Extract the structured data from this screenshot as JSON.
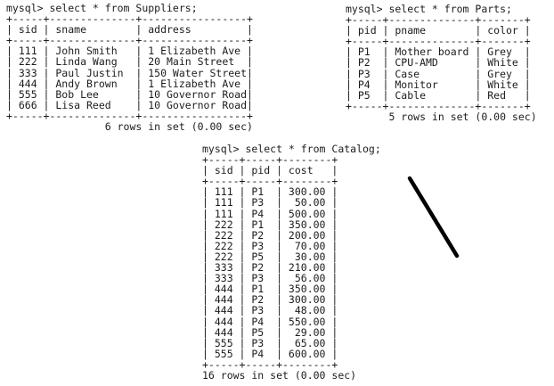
{
  "suppliers": {
    "prompt": "mysql> select * from Suppliers;",
    "border": "+-----+--------------+-----------------+",
    "header": "| sid | sname        | address         |",
    "rows": [
      "| 111 | John Smith   | 1 Elizabeth Ave |",
      "| 222 | Linda Wang   | 20 Main Street  |",
      "| 333 | Paul Justin  | 150 Water Street|",
      "| 444 | Andy Brown   | 1 Elizabeth Ave |",
      "| 555 | Bob Lee      | 10 Governor Road|",
      "| 666 | Lisa Reed    | 10 Governor Road|"
    ],
    "footer": "                6 rows in set (0.00 sec)"
  },
  "parts": {
    "prompt": "mysql> select * from Parts;",
    "border": "+-----+--------------+-------+",
    "header": "| pid | pname        | color |",
    "rows": [
      "| P1  | Mother board | Grey  |",
      "| P2  | CPU-AMD      | White |",
      "| P3  | Case         | Grey  |",
      "| P4  | Monitor      | White |",
      "| P5  | Cable        | Red   |"
    ],
    "footer": "       5 rows in set (0.00 sec)"
  },
  "catalog": {
    "prompt": "mysql> select * from Catalog;",
    "border": "+-----+-----+--------+",
    "header": "| sid | pid | cost   |",
    "rows": [
      "| 111 | P1  | 300.00 |",
      "| 111 | P3  |  50.00 |",
      "| 111 | P4  | 500.00 |",
      "| 222 | P1  | 350.00 |",
      "| 222 | P2  | 200.00 |",
      "| 222 | P3  |  70.00 |",
      "| 222 | P5  |  30.00 |",
      "| 333 | P2  | 210.00 |",
      "| 333 | P3  |  56.00 |",
      "| 444 | P1  | 350.00 |",
      "| 444 | P2  | 300.00 |",
      "| 444 | P3  |  48.00 |",
      "| 444 | P4  | 550.00 |",
      "| 444 | P5  |  29.00 |",
      "| 555 | P3  |  65.00 |",
      "| 555 | P4  | 600.00 |"
    ],
    "footer": "16 rows in set (0.00 sec)"
  },
  "colors": {
    "text": "#1c1c1c",
    "background": "#ffffff",
    "stroke": "#000000"
  }
}
